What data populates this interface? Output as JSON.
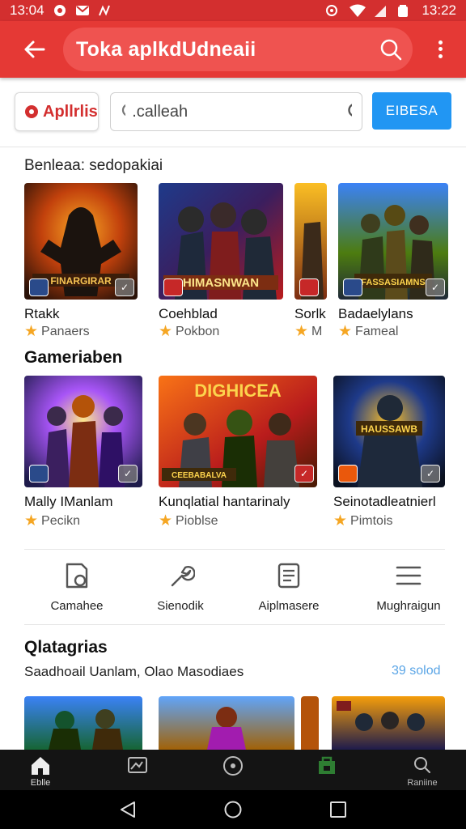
{
  "status_bar": {
    "time": "13:04",
    "right_time": "13:22"
  },
  "app_bar": {
    "title": "Toka aplkdUdneaii"
  },
  "search": {
    "chip_label": "Apllrlis",
    "placeholder": ".calleah",
    "button_label": "EIBESA"
  },
  "section1": {
    "label": "Benleaa: sedopakiai",
    "items": [
      {
        "name": "Rtakk",
        "meta": "Panaers"
      },
      {
        "name": "Coehblad",
        "meta": "Pokbon"
      },
      {
        "name": "Sorlk",
        "meta": "M"
      },
      {
        "name": "Badaelylans",
        "meta": "Fameal"
      }
    ]
  },
  "section2": {
    "title": "Gameriaben",
    "items": [
      {
        "name": "Mally IManlam",
        "meta": "Pecikn"
      },
      {
        "name": "Kunqlatial hantarinaly",
        "meta": "Pioblse"
      },
      {
        "name": "Seinotadleatnierl",
        "meta": "Pimtois"
      }
    ]
  },
  "actions": [
    {
      "label": "Camahee",
      "icon": "book-icon"
    },
    {
      "label": "Sienodik",
      "icon": "wrench-icon"
    },
    {
      "label": "Aiplmasere",
      "icon": "document-icon"
    },
    {
      "label": "Mughraigun",
      "icon": "menu-icon"
    }
  ],
  "section3": {
    "title": "Qlatagrias",
    "subtitle": "Saadhoail Uanlam, Olao Masodiaes",
    "link": "39 solod"
  },
  "bottom_nav": [
    {
      "label": "Eblle",
      "icon": "home-icon",
      "active": true
    },
    {
      "label": "",
      "icon": "image-icon"
    },
    {
      "label": "",
      "icon": "circle-play-icon"
    },
    {
      "label": "",
      "icon": "store-icon"
    },
    {
      "label": "Raniine",
      "icon": "search-icon"
    }
  ],
  "colors": {
    "brand_red": "#e53935",
    "accent_blue": "#2196f3",
    "star": "#f5a623"
  }
}
